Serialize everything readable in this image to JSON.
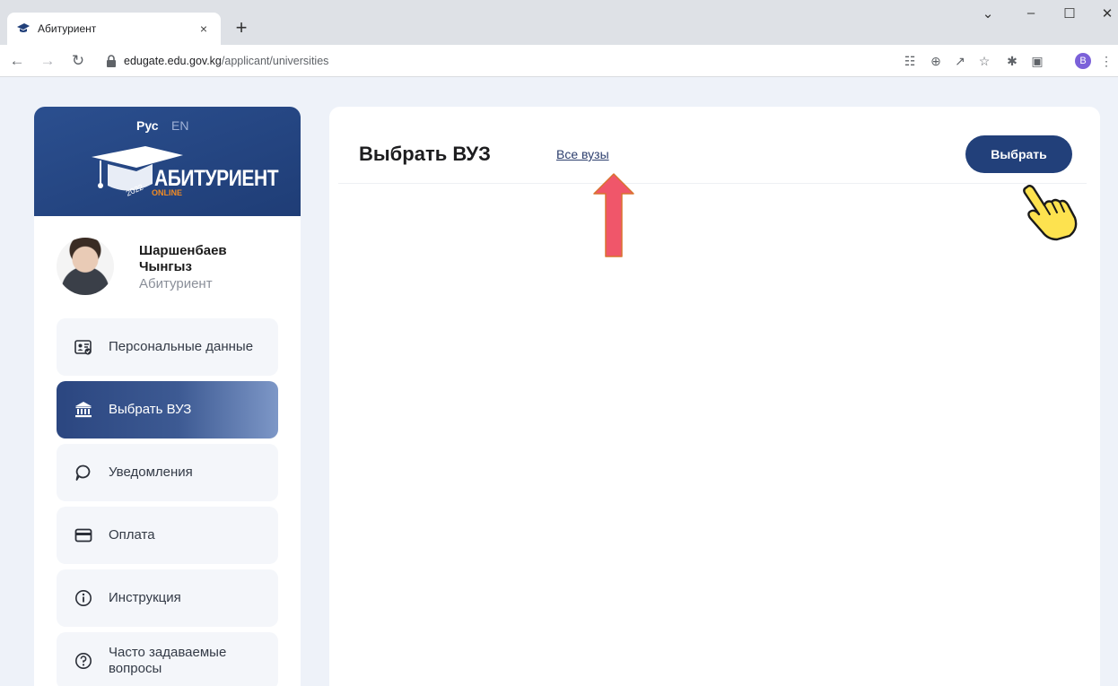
{
  "browser": {
    "tab_title": "Абитуриент",
    "tab_close": "×",
    "new_tab": "+",
    "url_host": "edugate.edu.gov.kg",
    "url_path": "/applicant/universities",
    "profile_initial": "B"
  },
  "sidebar": {
    "lang_ru": "Рус",
    "lang_en": "EN",
    "logo_text": "АБИТУРИЕНТ",
    "logo_online": "ONLINE",
    "logo_year": "2022",
    "user_name": "Шаршенбаев Чынгыз",
    "user_role": "Абитуриент",
    "menu": [
      {
        "label": "Персональные данные",
        "icon": "id-card-icon"
      },
      {
        "label": "Выбрать ВУЗ",
        "icon": "university-icon",
        "active": true
      },
      {
        "label": "Уведомления",
        "icon": "chat-bubble-icon"
      },
      {
        "label": "Оплата",
        "icon": "credit-card-icon"
      },
      {
        "label": "Инструкция",
        "icon": "info-icon"
      },
      {
        "label": "Часто задаваемые вопросы",
        "icon": "help-icon"
      }
    ]
  },
  "main": {
    "title": "Выбрать ВУЗ",
    "all_unis_link": "Все вузы",
    "select_button": "Выбрать"
  },
  "colors": {
    "primary": "#22407a",
    "annotation_arrow": "#f0566a",
    "pointer_hand": "#fde24f"
  }
}
